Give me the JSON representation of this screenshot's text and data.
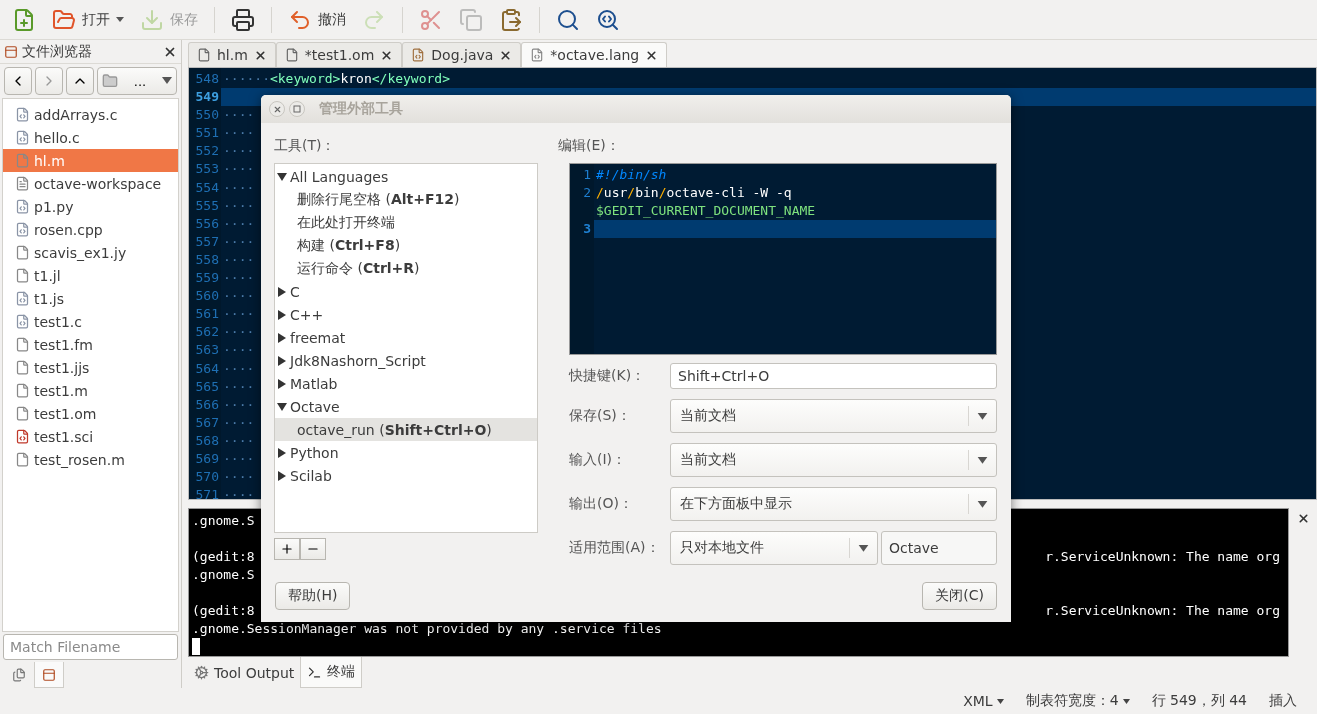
{
  "toolbar": [
    {
      "kind": "new",
      "disabled": false
    },
    {
      "kind": "open",
      "label": "打开",
      "disabled": false
    },
    {
      "kind": "save",
      "label": "保存",
      "disabled": true
    },
    {
      "kind": "separator"
    },
    {
      "kind": "print",
      "disabled": false
    },
    {
      "kind": "separator"
    },
    {
      "kind": "undo",
      "label": "撤消",
      "disabled": false
    },
    {
      "kind": "redo",
      "disabled": true
    },
    {
      "kind": "separator"
    },
    {
      "kind": "cut",
      "disabled": true
    },
    {
      "kind": "copy",
      "disabled": true
    },
    {
      "kind": "paste",
      "disabled": false
    },
    {
      "kind": "separator"
    },
    {
      "kind": "find",
      "disabled": false
    },
    {
      "kind": "replace",
      "disabled": false
    }
  ],
  "side_panel": {
    "title": "文件浏览器",
    "location": "...",
    "files": [
      {
        "name": "addArrays.c",
        "kind": "source",
        "selected": false
      },
      {
        "name": "hello.c",
        "kind": "source",
        "selected": false
      },
      {
        "name": "hl.m",
        "kind": "plain",
        "selected": true
      },
      {
        "name": "octave-workspace",
        "kind": "binary",
        "selected": false
      },
      {
        "name": "p1.py",
        "kind": "source",
        "selected": false
      },
      {
        "name": "rosen.cpp",
        "kind": "source",
        "selected": false
      },
      {
        "name": "scavis_ex1.jy",
        "kind": "plain",
        "selected": false
      },
      {
        "name": "t1.jl",
        "kind": "plain",
        "selected": false
      },
      {
        "name": "t1.js",
        "kind": "source",
        "selected": false
      },
      {
        "name": "test1.c",
        "kind": "source",
        "selected": false
      },
      {
        "name": "test1.fm",
        "kind": "plain",
        "selected": false
      },
      {
        "name": "test1.jjs",
        "kind": "plain",
        "selected": false
      },
      {
        "name": "test1.m",
        "kind": "plain",
        "selected": false
      },
      {
        "name": "test1.om",
        "kind": "plain",
        "selected": false
      },
      {
        "name": "test1.sci",
        "kind": "sci",
        "selected": false
      },
      {
        "name": "test_rosen.m",
        "kind": "plain",
        "selected": false
      }
    ],
    "filter": {
      "placeholder": "Match Filename"
    },
    "tabs": [
      {
        "kind": "documents",
        "selected": false
      },
      {
        "kind": "files",
        "selected": true
      }
    ]
  },
  "document_tabs": [
    {
      "label": "hl.m",
      "kind": "plain",
      "selected": false
    },
    {
      "label": "*test1.om",
      "kind": "plain",
      "selected": false
    },
    {
      "label": "Dog.java",
      "kind": "java",
      "selected": false
    },
    {
      "label": "*octave.lang",
      "kind": "xml",
      "selected": true
    }
  ],
  "editor": {
    "lines": [
      {
        "number": "548",
        "current": false,
        "tokens": [
          {
            "text": "······",
            "kind": "space"
          },
          {
            "text": "<keyword>",
            "kind": "tag"
          },
          {
            "text": "kron",
            "kind": "plain"
          },
          {
            "text": "</keyword>",
            "kind": "tag"
          }
        ]
      },
      {
        "number": "549",
        "current": true
      },
      {
        "number": "550",
        "current": false,
        "tokens": [
          {
            "text": "····",
            "kind": "space"
          }
        ]
      },
      {
        "number": "551",
        "current": false,
        "tokens": [
          {
            "text": "····",
            "kind": "space"
          }
        ]
      },
      {
        "number": "552",
        "current": false,
        "tokens": [
          {
            "text": "····",
            "kind": "space"
          }
        ]
      },
      {
        "number": "553",
        "current": false,
        "tokens": [
          {
            "text": "····",
            "kind": "space"
          }
        ]
      },
      {
        "number": "554",
        "current": false,
        "tokens": [
          {
            "text": "····",
            "kind": "space"
          }
        ]
      },
      {
        "number": "555",
        "current": false,
        "tokens": [
          {
            "text": "····",
            "kind": "space"
          }
        ]
      },
      {
        "number": "556",
        "current": false,
        "tokens": [
          {
            "text": "····",
            "kind": "space"
          }
        ]
      },
      {
        "number": "557",
        "current": false,
        "tokens": [
          {
            "text": "····",
            "kind": "space"
          }
        ]
      },
      {
        "number": "558",
        "current": false,
        "tokens": [
          {
            "text": "····",
            "kind": "space"
          }
        ]
      },
      {
        "number": "559",
        "current": false,
        "tokens": [
          {
            "text": "····",
            "kind": "space"
          }
        ]
      },
      {
        "number": "560",
        "current": false,
        "tokens": [
          {
            "text": "····",
            "kind": "space"
          }
        ]
      },
      {
        "number": "561",
        "current": false,
        "tokens": [
          {
            "text": "····",
            "kind": "space"
          }
        ]
      },
      {
        "number": "562",
        "current": false,
        "tokens": [
          {
            "text": "····",
            "kind": "space"
          }
        ]
      },
      {
        "number": "563",
        "current": false,
        "tokens": [
          {
            "text": "····",
            "kind": "space"
          }
        ]
      },
      {
        "number": "564",
        "current": false,
        "tokens": [
          {
            "text": "····",
            "kind": "space"
          }
        ]
      },
      {
        "number": "565",
        "current": false,
        "tokens": [
          {
            "text": "····",
            "kind": "space"
          }
        ]
      },
      {
        "number": "566",
        "current": false,
        "tokens": [
          {
            "text": "····",
            "kind": "space"
          }
        ]
      },
      {
        "number": "567",
        "current": false,
        "tokens": [
          {
            "text": "····",
            "kind": "space"
          }
        ]
      },
      {
        "number": "568",
        "current": false,
        "tokens": [
          {
            "text": "····",
            "kind": "space"
          }
        ]
      },
      {
        "number": "569",
        "current": false,
        "tokens": [
          {
            "text": "····",
            "kind": "space"
          }
        ]
      },
      {
        "number": "570",
        "current": false,
        "tokens": [
          {
            "text": "····",
            "kind": "space"
          }
        ]
      },
      {
        "number": "571",
        "current": false,
        "tokens": [
          {
            "text": "····",
            "kind": "space"
          }
        ]
      }
    ]
  },
  "bottom_panel": {
    "terminal": {
      "blocks": [
        [
          {
            "left": ".gnome.S"
          }
        ],
        [
          {
            "left": "(gedit:8",
            "right": "r.ServiceUnknown: The name org"
          },
          {
            "left": ".gnome.S"
          }
        ],
        [
          {
            "left": "(gedit:8",
            "right": "r.ServiceUnknown: The name org"
          },
          {
            "left": ".gnome.SessionManager was not provided by any .service files"
          }
        ]
      ],
      "cursor": true
    },
    "tabs": [
      {
        "label": "Tool Output",
        "kind": "tools",
        "selected": false
      },
      {
        "label": "终端",
        "kind": "terminal",
        "selected": true
      }
    ]
  },
  "status_bar": [
    {
      "text": "XML",
      "kind": "menu"
    },
    {
      "text": "制表符宽度：4",
      "kind": "menu"
    },
    {
      "text": "行 549，列 44",
      "kind": "text"
    },
    {
      "text": "插入",
      "kind": "text"
    }
  ],
  "dialog": {
    "title": "管理外部工具",
    "tools_label": "工具(T)：",
    "tools": [
      {
        "label": "All Languages",
        "expanded": true,
        "selected": false,
        "children": [
          {
            "label": "删除行尾空格 (**Alt+F12**)",
            "selected": false
          },
          {
            "label": "在此处打开终端",
            "selected": false
          },
          {
            "label": "构建 (**Ctrl+F8**)",
            "selected": false
          },
          {
            "label": "运行命令 (**Ctrl+R**)",
            "selected": false
          }
        ]
      },
      {
        "label": "C",
        "expanded": false,
        "selected": false
      },
      {
        "label": "C++",
        "expanded": false,
        "selected": false
      },
      {
        "label": "freemat",
        "expanded": false,
        "selected": false
      },
      {
        "label": "Jdk8Nashorn_Script",
        "expanded": false,
        "selected": false
      },
      {
        "label": "Matlab",
        "expanded": false,
        "selected": false
      },
      {
        "label": "Octave",
        "expanded": true,
        "selected": false,
        "children": [
          {
            "label": "octave_run (**Shift+Ctrl+O**)",
            "selected": true
          }
        ]
      },
      {
        "label": "Python",
        "expanded": false,
        "selected": false
      },
      {
        "label": "Scilab",
        "expanded": false,
        "selected": false
      }
    ],
    "edit_label": "编辑(E)：",
    "code": [
      {
        "number": "1",
        "current": false,
        "tokens": [
          {
            "text": "#!/bin/sh",
            "kind": "comment"
          }
        ]
      },
      {
        "number": "2",
        "current": false,
        "tokens": [
          {
            "text": "/",
            "kind": "slash"
          },
          {
            "text": "usr",
            "kind": "plain"
          },
          {
            "text": "/",
            "kind": "slash"
          },
          {
            "text": "bin",
            "kind": "plain"
          },
          {
            "text": "/",
            "kind": "slash"
          },
          {
            "text": "octave-cli -W -q",
            "kind": "plain"
          }
        ]
      },
      {
        "current": false,
        "tokens": [
          {
            "text": "$GEDIT_CURRENT_DOCUMENT_NAME",
            "kind": "variable"
          }
        ]
      },
      {
        "number": "3",
        "current": true
      }
    ],
    "fields": [
      {
        "label": "快捷键(K)：",
        "kind": "entry",
        "value": "Shift+Ctrl+O"
      },
      {
        "label": "保存(S)：",
        "kind": "combo",
        "value": "当前文档"
      },
      {
        "label": "输入(I)：",
        "kind": "combo",
        "value": "当前文档"
      },
      {
        "label": "输出(O)：",
        "kind": "combo",
        "value": "在下方面板中显示"
      },
      {
        "label": "适用范围(A)：",
        "kind": "combo_entry",
        "value": "只对本地文件",
        "entry": "Octave"
      }
    ],
    "help_button": "帮助(H)",
    "close_button": "关闭(C)"
  }
}
